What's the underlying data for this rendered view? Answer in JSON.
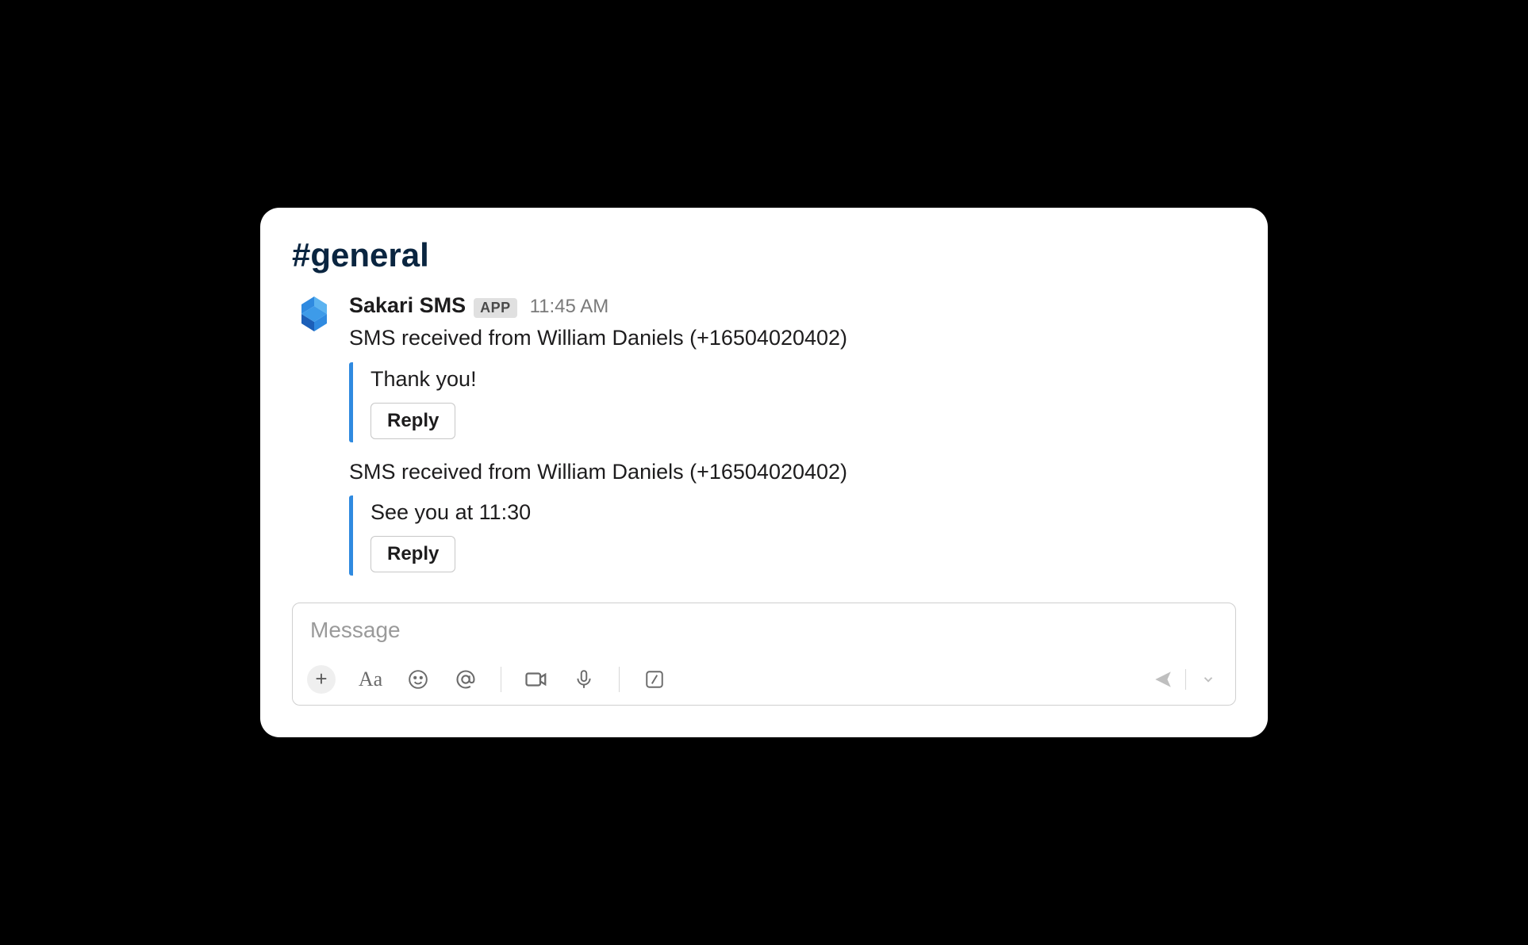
{
  "channel": {
    "name": "#general"
  },
  "message": {
    "sender_name": "Sakari SMS",
    "app_badge": "APP",
    "timestamp": "11:45 AM",
    "sms": [
      {
        "header": "SMS received from William Daniels (+16504020402)",
        "body": "Thank you!",
        "reply_label": "Reply"
      },
      {
        "header": "SMS received from William Daniels (+16504020402)",
        "body": "See you at 11:30",
        "reply_label": "Reply"
      }
    ]
  },
  "composer": {
    "placeholder": "Message"
  }
}
